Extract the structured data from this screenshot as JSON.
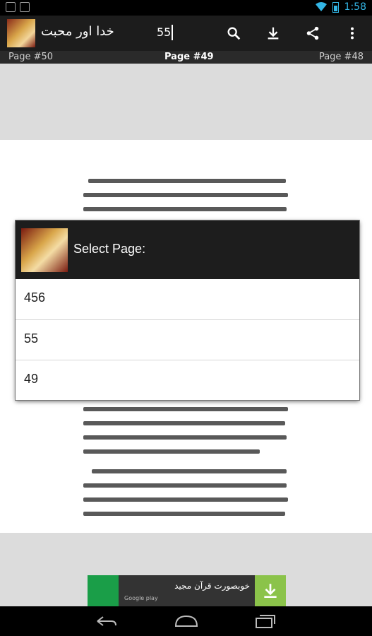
{
  "status_bar": {
    "time": "1:58"
  },
  "action_bar": {
    "title": "خدا اور محبت",
    "search_value": "55",
    "icons": [
      "search-icon",
      "download-icon",
      "share-icon",
      "overflow-menu-icon"
    ]
  },
  "page_bar": {
    "prev": "Page #50",
    "current": "Page #49",
    "next": "Page #48"
  },
  "dialog": {
    "title": "Select Page:",
    "items": [
      "456",
      "55",
      "49"
    ]
  },
  "ad": {
    "text": "خوبصورت قرآن مجید",
    "sub": "Google play"
  },
  "colors": {
    "accent": "#33b5e5",
    "dialog_header": "#1d1d1d",
    "ad_green": "#8bc34a"
  }
}
